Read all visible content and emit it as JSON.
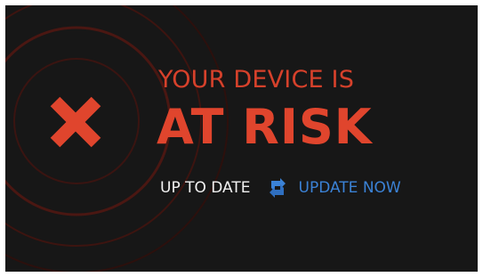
{
  "alert": {
    "headline_top": "YOUR DEVICE IS",
    "headline_main": "AT RISK",
    "status_label": "UP TO DATE",
    "action_label": "UPDATE NOW"
  },
  "icons": {
    "status": "close-icon",
    "action": "refresh-icon"
  },
  "colors": {
    "background": "#171717",
    "alert_red": "#e0452d",
    "ring_red": "#5a1a14",
    "link_blue": "#3b82d6",
    "text_white": "#f2f2f2"
  }
}
